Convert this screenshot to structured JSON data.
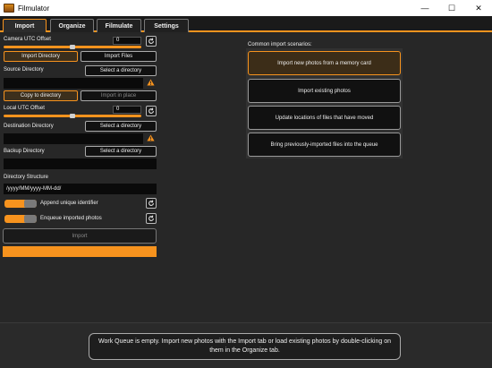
{
  "window": {
    "title": "Filmulator",
    "controls": {
      "minimize": "—",
      "maximize": "☐",
      "close": "✕"
    }
  },
  "tabs": [
    {
      "label": "Import",
      "active": true
    },
    {
      "label": "Organize",
      "active": false
    },
    {
      "label": "Filmulate",
      "active": false
    },
    {
      "label": "Settings",
      "active": false
    }
  ],
  "import": {
    "camera_utc_offset": {
      "label": "Camera UTC Offset",
      "value": "0"
    },
    "mode_buttons": {
      "directory": "Import Directory",
      "files": "Import Files",
      "selected": "directory"
    },
    "source_directory": {
      "label": "Source Directory",
      "button": "Select a directory",
      "value": ""
    },
    "copy_mode": {
      "copy": "Copy to directory",
      "in_place": "Import in place",
      "selected": "copy"
    },
    "local_utc_offset": {
      "label": "Local UTC Offset",
      "value": "0"
    },
    "destination_directory": {
      "label": "Destination Directory",
      "button": "Select a directory",
      "value": ""
    },
    "backup_directory": {
      "label": "Backup Directory",
      "button": "Select a directory",
      "value": ""
    },
    "directory_structure": {
      "label": "Directory Structure",
      "value": "/yyyy/MM/yyyy-MM-dd/"
    },
    "append_unique_identifier": {
      "label": "Append unique identifier",
      "on": true
    },
    "enqueue_imported_photos": {
      "label": "Enqueue imported photos",
      "on": true
    },
    "import_button": "Import",
    "progress": 1.0
  },
  "scenarios": {
    "title": "Common import scenarios:",
    "items": [
      {
        "label": "Import new photos from a memory card",
        "selected": true
      },
      {
        "label": "Import existing photos",
        "selected": false
      },
      {
        "label": "Update locations of files that have moved",
        "selected": false
      },
      {
        "label": "Bring previously-imported files into the queue",
        "selected": false
      }
    ]
  },
  "work_queue": {
    "message": "Work Queue is empty. Import new photos with the Import tab or load existing photos by double-clicking on them in the Organize tab."
  },
  "icons": {
    "reset": "reset-icon",
    "warning": "warning-icon"
  },
  "colors": {
    "accent": "#f7931e",
    "background": "#272727"
  }
}
